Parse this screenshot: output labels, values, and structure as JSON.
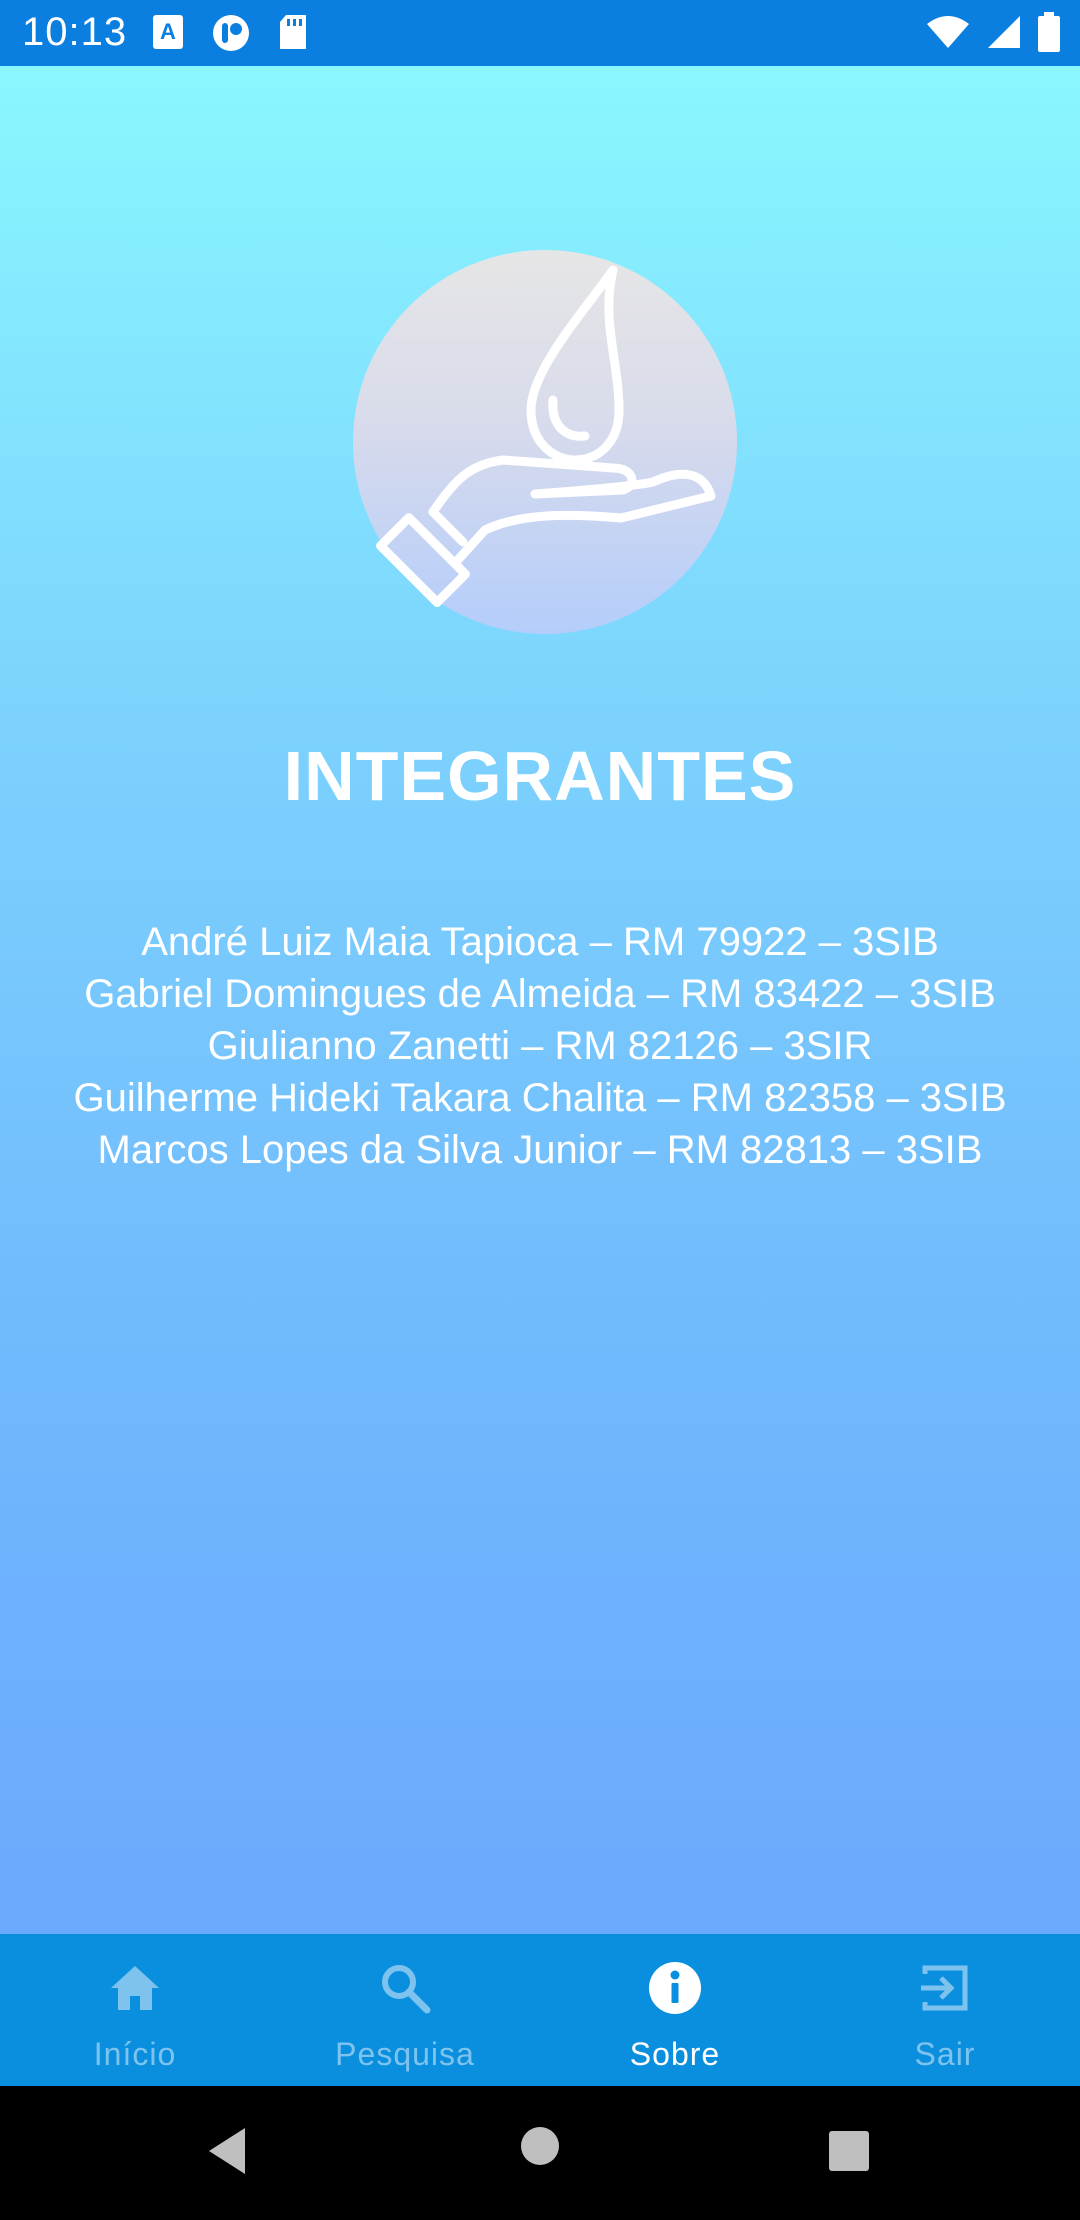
{
  "status_bar": {
    "time": "10:13",
    "left_icons": [
      "keyboard-a-icon",
      "app-icon",
      "sd-card-icon"
    ],
    "right_icons": [
      "wifi-icon",
      "signal-icon",
      "battery-icon"
    ]
  },
  "colors": {
    "status_bar": "#0a7fe0",
    "bottom_nav": "#0a8fdf",
    "nav_inactive": "#7ec3ee",
    "nav_active": "#ffffff",
    "gradient_top": "#8af7ff",
    "gradient_bottom": "#6aa9fd"
  },
  "main": {
    "logo_icon": "hand-water-drop-icon",
    "title": "INTEGRANTES",
    "members": [
      "André Luiz Maia Tapioca – RM 79922 – 3SIB",
      "Gabriel Domingues de Almeida – RM 83422 – 3SIB",
      "Giulianno Zanetti – RM 82126 – 3SIR",
      "Guilherme Hideki Takara Chalita – RM 82358 – 3SIB",
      "Marcos Lopes da Silva Junior – RM 82813 – 3SIB"
    ]
  },
  "bottom_nav": {
    "items": [
      {
        "label": "Início",
        "icon": "home-icon",
        "active": false
      },
      {
        "label": "Pesquisa",
        "icon": "search-icon",
        "active": false
      },
      {
        "label": "Sobre",
        "icon": "info-icon",
        "active": true
      },
      {
        "label": "Sair",
        "icon": "exit-icon",
        "active": false
      }
    ]
  },
  "system_nav": {
    "buttons": [
      "back-icon",
      "home-circle-icon",
      "recents-icon"
    ]
  }
}
